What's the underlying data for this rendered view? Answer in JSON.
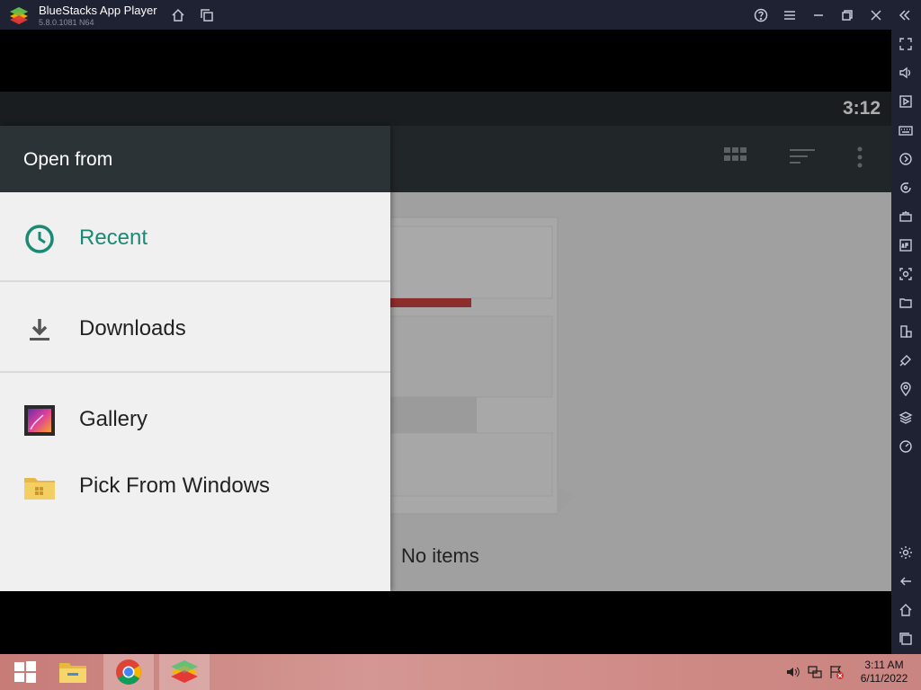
{
  "window": {
    "title": "BlueStacks App Player",
    "version": "5.8.0.1081 N64"
  },
  "android": {
    "clock": "3:12",
    "empty_text": "No items"
  },
  "drawer": {
    "title": "Open from",
    "items": [
      {
        "label": "Recent",
        "icon": "clock-icon",
        "color": "#1a8a75"
      },
      {
        "label": "Downloads",
        "icon": "download-icon"
      },
      {
        "label": "Gallery",
        "icon": "gallery-icon"
      },
      {
        "label": "Pick From Windows",
        "icon": "windows-folder-icon"
      }
    ]
  },
  "taskbar": {
    "time": "3:11 AM",
    "date": "6/11/2022"
  },
  "colors": {
    "titlebar": "#1f2233",
    "drawer_header": "#2b3336",
    "accent": "#1a8a75"
  }
}
